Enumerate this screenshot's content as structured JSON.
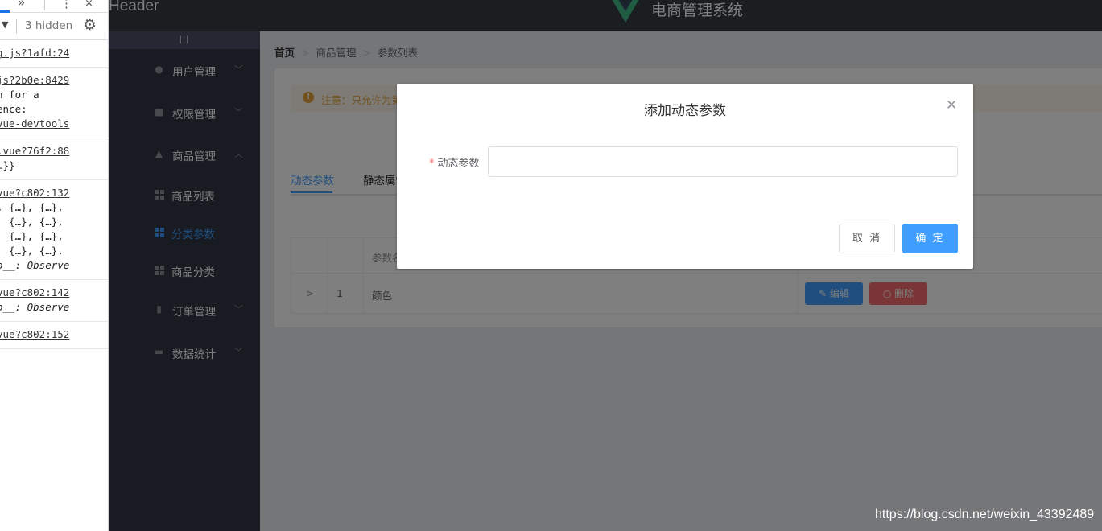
{
  "devtools": {
    "hidden_label": "3 hidden",
    "blocks": [
      {
        "lines": [
          {
            "t": "g.js?1afd:24",
            "cls": "link"
          }
        ]
      },
      {
        "lines": [
          {
            "t": "js?2b0e:8429",
            "cls": "link"
          },
          {
            "t": "n for a",
            "cls": ""
          },
          {
            "t": "ence:",
            "cls": ""
          },
          {
            "t": "vue-devtools",
            "cls": "link"
          }
        ]
      },
      {
        "lines": [
          {
            "t": ".vue?76f2:88",
            "cls": "link"
          },
          {
            "t": "…}}",
            "cls": ""
          }
        ]
      },
      {
        "lines": [
          {
            "t": "vue?c802:132",
            "cls": "link"
          },
          {
            "t": ", {…}, {…},",
            "cls": ""
          },
          {
            "t": "  {…}, {…},",
            "cls": ""
          },
          {
            "t": "  {…}, {…},",
            "cls": ""
          },
          {
            "t": "  {…}, {…},",
            "cls": ""
          },
          {
            "t": "o__: Observe",
            "cls": "it"
          }
        ]
      },
      {
        "lines": [
          {
            "t": "vue?c802:142",
            "cls": "link"
          },
          {
            "t": "o__: Observe",
            "cls": "it"
          }
        ]
      },
      {
        "lines": [
          {
            "t": "vue?c802:152",
            "cls": "link"
          }
        ]
      }
    ]
  },
  "header": {
    "left_text": "Header",
    "title": "电商管理系统"
  },
  "sidebar": {
    "toggle": "|||",
    "menus": [
      {
        "label": "用户管理",
        "icon": "user-icon",
        "chevron": "﹀"
      },
      {
        "label": "权限管理",
        "icon": "box-icon",
        "chevron": "﹀"
      },
      {
        "label": "商品管理",
        "icon": "shopping-bag-icon",
        "chevron": "︿"
      },
      {
        "label": "订单管理",
        "icon": "clipboard-icon",
        "chevron": "﹀"
      },
      {
        "label": "数据统计",
        "icon": "chart-icon",
        "chevron": "﹀"
      }
    ],
    "submenus": [
      {
        "label": "商品列表"
      },
      {
        "label": "分类参数"
      },
      {
        "label": "商品分类"
      }
    ],
    "active_color": "#409eff"
  },
  "breadcrumb": [
    "首页",
    "商品管理",
    "参数列表"
  ],
  "alert": {
    "text": "注意：只允许为第"
  },
  "tabs": [
    "动态参数",
    "静态属性"
  ],
  "table": {
    "header": "参数名",
    "rows": [
      {
        "index": "1",
        "name": "颜色"
      }
    ],
    "edit_label": "编辑",
    "delete_label": "删除"
  },
  "dialog": {
    "title": "添加动态参数",
    "field_label": "动态参数",
    "field_value": "",
    "cancel_label": "取 消",
    "confirm_label": "确 定"
  },
  "watermark": "https://blog.csdn.net/weixin_43392489"
}
